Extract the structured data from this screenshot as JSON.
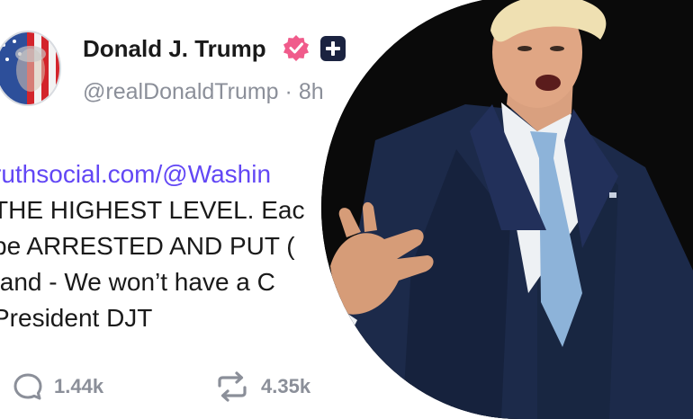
{
  "post": {
    "display_name": "Donald J. Trump",
    "handle": "@realDonaldTrump",
    "separator": "·",
    "time": "8h",
    "lines": [
      "ruthsocial.com/@Washin",
      "THE HIGHEST LEVEL. Eac",
      "be ARRESTED AND PUT (",
      "tand - We won’t have a C",
      "President DJT"
    ],
    "replies_count": "1.44k",
    "retruths_count": "4.35k"
  },
  "colors": {
    "link": "#6247f5",
    "verified": "#f05b8b",
    "badge_bg": "#1b2340",
    "muted": "#8b8f99"
  },
  "icons": [
    "avatar-flag-portrait",
    "verified-badge-icon",
    "plus-badge-icon",
    "reply-icon",
    "retruth-icon"
  ]
}
